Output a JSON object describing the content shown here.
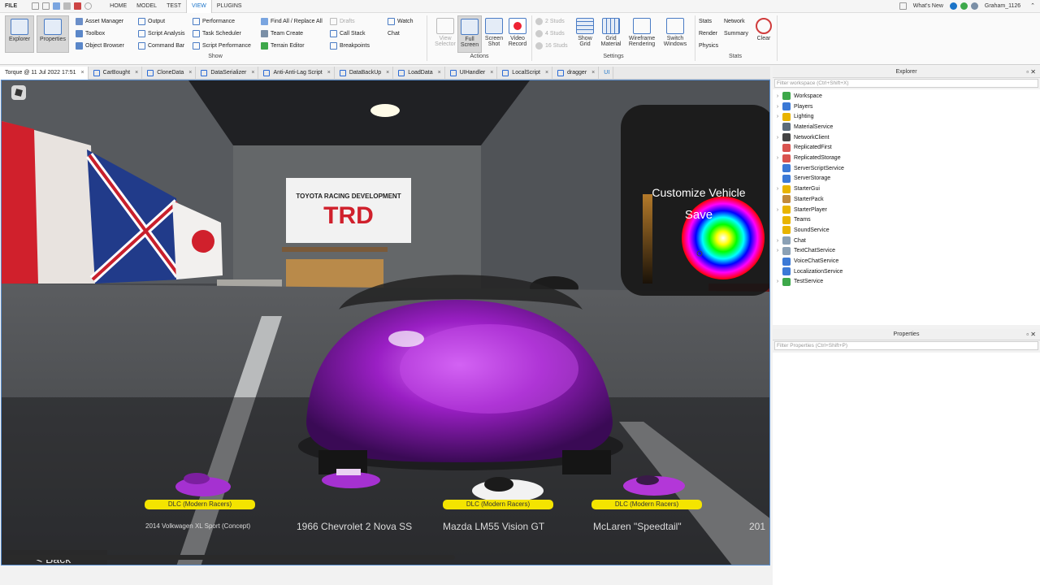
{
  "menu": {
    "file": "FILE",
    "tabs": [
      "HOME",
      "MODEL",
      "TEST",
      "VIEW",
      "PLUGINS"
    ],
    "active_tab": "VIEW",
    "whats_new": "What's New",
    "user": "Graham_1126"
  },
  "ribbon": {
    "explorer": "Explorer",
    "properties": "Properties",
    "show_col1": [
      "Asset Manager",
      "Toolbox",
      "Object Browser"
    ],
    "show_col2": [
      "Output",
      "Script Analysis",
      "Command Bar"
    ],
    "show_col3": [
      "Performance",
      "Task Scheduler",
      "Script Performance"
    ],
    "show_col4": [
      "Find All / Replace All",
      "Team Create",
      "Terrain Editor"
    ],
    "show_col5": [
      "Drafts",
      "Call Stack",
      "Breakpoints"
    ],
    "show_col6": [
      "Watch",
      "Chat"
    ],
    "show_label": "Show",
    "actions": {
      "view_selector": "View Selector",
      "full_screen": "Full Screen",
      "screen_shot": "Screen Shot",
      "video_record": "Video Record",
      "label": "Actions"
    },
    "studs": [
      "2 Studs",
      "4 Studs",
      "16 Studs"
    ],
    "settings": {
      "show_grid": "Show Grid",
      "grid_material": "Grid Material",
      "wireframe": "Wireframe Rendering",
      "switch_windows": "Switch Windows",
      "label": "Settings"
    },
    "stats": {
      "stats": "Stats",
      "network": "Network",
      "render": "Render",
      "summary": "Summary",
      "physics": "Physics",
      "clear": "Clear",
      "label": "Stats"
    }
  },
  "doc_tabs": [
    {
      "label": "Torque @ 11 Jul 2022 17:51",
      "active": true
    },
    {
      "label": "CarBought"
    },
    {
      "label": "CloneData"
    },
    {
      "label": "DataSerializer"
    },
    {
      "label": "Anti-Anti-Lag Script"
    },
    {
      "label": "DataBackUp"
    },
    {
      "label": "LoadData"
    },
    {
      "label": "UIHandler"
    },
    {
      "label": "LocalScript"
    },
    {
      "label": "dragger"
    }
  ],
  "ui_toggle": "UI",
  "game": {
    "customize_title": "Customize Vehicle",
    "save": "Save",
    "back": "< Back",
    "dlc_tags": [
      "DLC (Modern Racers)",
      "DLC (Modern Racers)",
      "DLC (Modern Racers)"
    ],
    "car_names": [
      "2014 Volkwagen XL Sport (Concept)",
      "1966 Chevrolet 2 Nova SS",
      "Mazda LM55 Vision GT",
      "McLaren \"Speedtail\"",
      "201"
    ],
    "banner_top": "TOYOTA RACING DEVELOPMENT",
    "banner_logo": "TRD",
    "car_color": "#9a1fc4"
  },
  "explorer": {
    "title": "Explorer",
    "filter_placeholder": "Filter workspace (Ctrl+Shift+X)",
    "items": [
      {
        "label": "Workspace",
        "caret": true,
        "icon_color": "#3da84a"
      },
      {
        "label": "Players",
        "caret": true,
        "icon_color": "#3b79d6"
      },
      {
        "label": "Lighting",
        "caret": true,
        "icon_color": "#e8b400"
      },
      {
        "label": "MaterialService",
        "caret": false,
        "icon_color": "#5b6b7a"
      },
      {
        "label": "NetworkClient",
        "caret": true,
        "icon_color": "#444444"
      },
      {
        "label": "ReplicatedFirst",
        "caret": false,
        "icon_color": "#d9534f"
      },
      {
        "label": "ReplicatedStorage",
        "caret": true,
        "icon_color": "#d9534f"
      },
      {
        "label": "ServerScriptService",
        "caret": false,
        "icon_color": "#3b79d6"
      },
      {
        "label": "ServerStorage",
        "caret": false,
        "icon_color": "#3b79d6"
      },
      {
        "label": "StarterGui",
        "caret": true,
        "icon_color": "#e8b400"
      },
      {
        "label": "StarterPack",
        "caret": false,
        "icon_color": "#c28a3a"
      },
      {
        "label": "StarterPlayer",
        "caret": true,
        "icon_color": "#e8b400"
      },
      {
        "label": "Teams",
        "caret": false,
        "icon_color": "#e8b400"
      },
      {
        "label": "SoundService",
        "caret": false,
        "icon_color": "#e8b400"
      },
      {
        "label": "Chat",
        "caret": true,
        "icon_color": "#8aa0b5"
      },
      {
        "label": "TextChatService",
        "caret": true,
        "icon_color": "#8aa0b5"
      },
      {
        "label": "VoiceChatService",
        "caret": false,
        "icon_color": "#3b79d6"
      },
      {
        "label": "LocalizationService",
        "caret": false,
        "icon_color": "#3b79d6"
      },
      {
        "label": "TestService",
        "caret": true,
        "icon_color": "#3da84a"
      }
    ]
  },
  "properties": {
    "title": "Properties",
    "filter_placeholder": "Filter Properties (Ctrl+Shift+P)"
  }
}
